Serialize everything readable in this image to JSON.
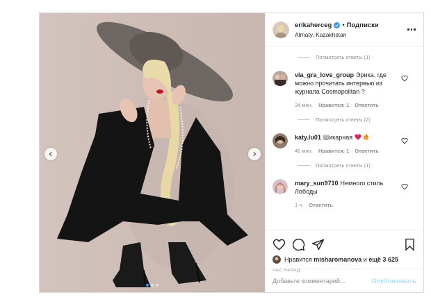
{
  "post": {
    "username": "erikaherceg",
    "separator": "•",
    "follow_label": "Подписки",
    "location": "Almaty, Kazakhstan",
    "icons": {
      "verified": "verified-badge-icon",
      "more": "more-options-icon",
      "prev": "chevron-left-icon",
      "next": "chevron-right-icon"
    },
    "carousel": {
      "slide_count": 3,
      "active_slide": 1
    }
  },
  "comments": {
    "reply_threads": [
      {
        "label": "Посмотреть ответы (1)"
      },
      {
        "label": "Посмотреть ответы (2)"
      },
      {
        "label": "Посмотреть ответы (1)"
      }
    ],
    "items": [
      {
        "user": "via_gra_love_group",
        "text": "Эрика, где можно прочитать интервью из журнала Cosmopolitan ?",
        "time": "34 мин.",
        "likes": "Нравится: 1",
        "reply": "Ответить"
      },
      {
        "user": "katy.lu01",
        "text": "Шикарная",
        "time": "40 мин.",
        "likes": "Нравится: 1",
        "reply": "Ответить"
      },
      {
        "user": "mary_sun9710",
        "text": "Немного стиль Лободы",
        "time": "1 ч.",
        "reply": "Ответить"
      }
    ]
  },
  "actions": {
    "likes_prefix": "Нравится",
    "likes_user": "misharomanova",
    "likes_and": "и",
    "likes_rest": "ещё 3 625",
    "timestamp": "ЧАС НАЗАД",
    "icons": [
      "heart-icon",
      "comment-icon",
      "share-icon",
      "bookmark-icon"
    ]
  },
  "composer": {
    "placeholder": "Добавьте комментарий...",
    "publish_label": "Опубликовать"
  },
  "colors": {
    "accent": "#3897f0",
    "publish_disabled": "#b2dffc",
    "muted": "#8e8e8e"
  }
}
